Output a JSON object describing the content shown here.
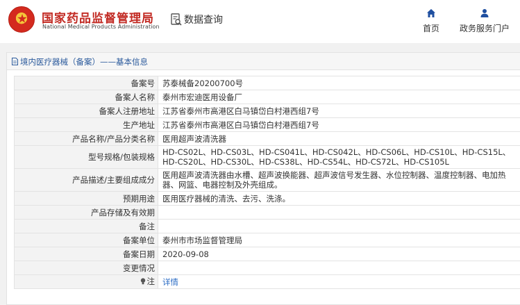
{
  "header": {
    "brand_cn": "国家药品监督管理局",
    "brand_en": "National Medical Products Administration",
    "page_title": "数据查询",
    "nav": [
      {
        "label": "首页",
        "icon": "home-icon"
      },
      {
        "label": "政务服务门户",
        "icon": "user-icon"
      }
    ]
  },
  "panel": {
    "breadcrumb": "境内医疗器械（备案）——基本信息"
  },
  "fields": [
    {
      "label": "备案号",
      "value": "苏泰械备20200700号"
    },
    {
      "label": "备案人名称",
      "value": "泰州市宏迪医用设备厂"
    },
    {
      "label": "备案人注册地址",
      "value": "江苏省泰州市高港区白马镇岱白村港西组7号"
    },
    {
      "label": "生产地址",
      "value": "江苏省泰州市高港区白马镇岱白村港西组7号"
    },
    {
      "label": "产品名称/产品分类名称",
      "value": "医用超声波清洗器"
    },
    {
      "label": "型号规格/包装规格",
      "value": "HD-CS02L、HD-CS03L、HD-CS041L、HD-CS042L、HD-CS06L、HD-CS10L、HD-CS15L、HD-CS20L、HD-CS30L、HD-CS38L、HD-CS54L、HD-CS72L、HD-CS105L"
    },
    {
      "label": "产品描述/主要组成成分",
      "value": "医用超声波清洗器由水槽、超声波换能器、超声波信号发生器、水位控制器、温度控制器、电加热器、网篮、电器控制及外壳组成。"
    },
    {
      "label": "预期用途",
      "value": "医用医疗器械的清洗、去污、洗涤。"
    },
    {
      "label": "产品存储及有效期",
      "value": ""
    },
    {
      "label": "备注",
      "value": ""
    },
    {
      "label": "备案单位",
      "value": "泰州市市场监督管理局"
    },
    {
      "label": "备案日期",
      "value": "2020-09-08"
    },
    {
      "label": "变更情况",
      "value": ""
    },
    {
      "label": "注",
      "value": "详情"
    }
  ],
  "colors": {
    "brand_red": "#c22b24",
    "link_blue": "#2b6cc4",
    "nav_blue": "#1f4fa0"
  }
}
